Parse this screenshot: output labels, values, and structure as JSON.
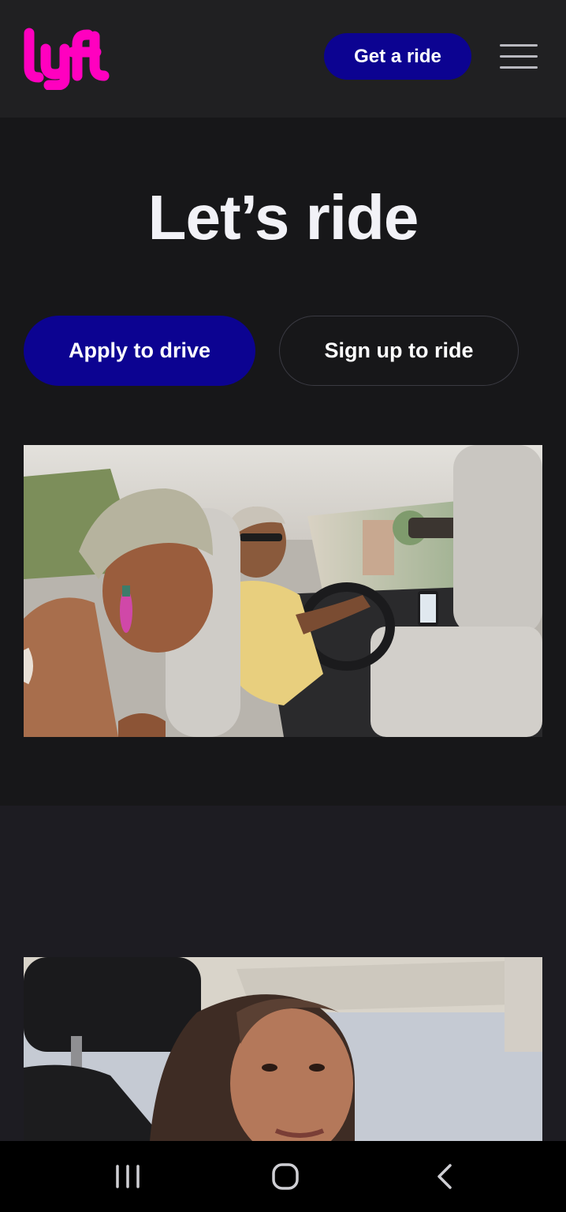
{
  "header": {
    "logo_text": "lyft",
    "get_ride_label": "Get a ride",
    "menu_icon": "hamburger-menu-icon"
  },
  "hero": {
    "title": "Let’s ride",
    "apply_label": "Apply to drive",
    "signup_label": "Sign up to ride"
  },
  "images": [
    {
      "name": "riders-in-car-photo"
    },
    {
      "name": "woman-in-car-photo"
    }
  ],
  "system_nav": {
    "recents_icon": "recent-apps-icon",
    "home_icon": "home-icon",
    "back_icon": "back-icon"
  },
  "colors": {
    "brand_pink": "#ff00bf",
    "button_blue": "#0c0391",
    "background": "#171719",
    "header": "#202022"
  }
}
